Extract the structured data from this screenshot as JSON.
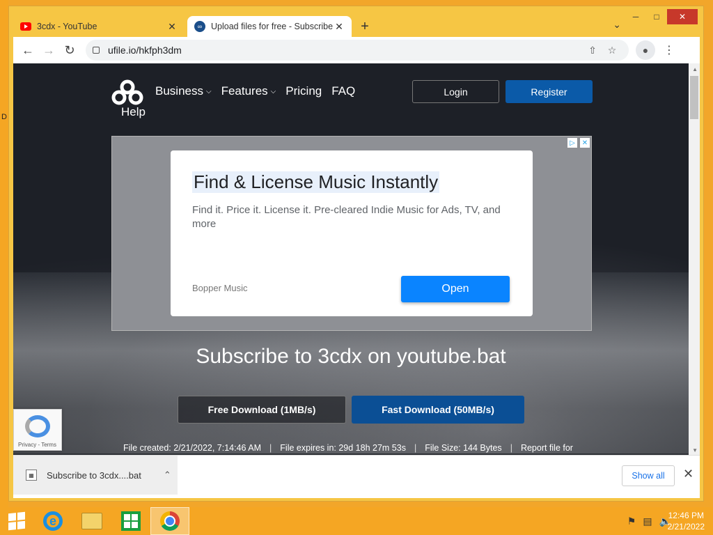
{
  "tabs": [
    {
      "title": "3cdx - YouTube",
      "icon": "youtube-icon"
    },
    {
      "title": "Upload files for free - Subscribe",
      "icon": "ufile-icon"
    }
  ],
  "toolbar": {
    "url": "ufile.io/hkfph3dm"
  },
  "site": {
    "help": "Help",
    "nav": [
      "Business",
      "Features",
      "Pricing",
      "FAQ"
    ],
    "login": "Login",
    "register": "Register"
  },
  "ad": {
    "headline": "Find & License Music Instantly",
    "body": "Find it. Price it. License it. Pre-cleared Indie Music for Ads, TV, and more",
    "advertiser": "Bopper Music",
    "cta": "Open"
  },
  "main": {
    "heading": "Subscribe to 3cdx on youtube.bat",
    "free_download": "Free Download (1MB/s)",
    "fast_download": "Fast Download (50MB/s)",
    "file_created": "File created: 2/21/2022, 7:14:46 AM",
    "file_expires": "File expires in: 29d 18h 27m 53s",
    "file_size": "File Size: 144 Bytes",
    "report": "Report file for"
  },
  "recaptcha": {
    "text": "Privacy - Terms"
  },
  "download_bar": {
    "filename": "Subscribe to 3cdx....bat",
    "show_all": "Show all"
  },
  "taskbar": {
    "time": "12:46 PM",
    "date": "2/21/2022"
  }
}
